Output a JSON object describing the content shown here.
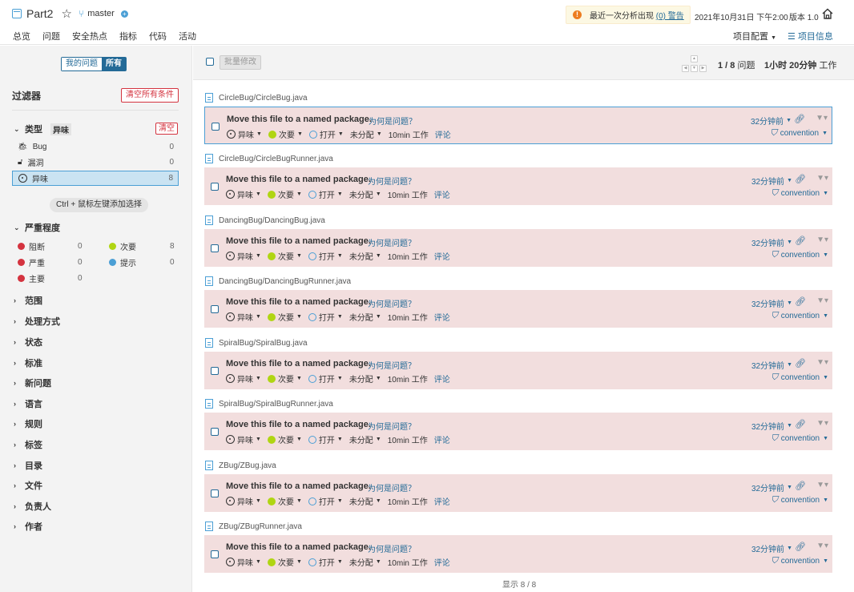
{
  "header": {
    "project": "Part2",
    "branch": "master",
    "warning_text": "最近一次分析出现",
    "warning_link": "(0) 警告",
    "date": "2021年10月31日 下午2:00",
    "version": "版本 1.0",
    "project_config": "项目配置",
    "project_info": "项目信息",
    "nav": [
      "总览",
      "问题",
      "安全热点",
      "指标",
      "代码",
      "活动"
    ]
  },
  "sidebar": {
    "my_issues": "我的问题",
    "all": "所有",
    "filters_title": "过滤器",
    "clear_all": "清空所有条件",
    "type": {
      "label": "类型",
      "badge": "异味",
      "clear": "清空",
      "items": [
        {
          "label": "Bug",
          "count": "0"
        },
        {
          "label": "漏洞",
          "count": "0"
        },
        {
          "label": "异味",
          "count": "8"
        }
      ]
    },
    "ctrl_hint": "Ctrl + 鼠标左键添加选择",
    "severity": {
      "label": "严重程度",
      "items": [
        {
          "label": "阻断",
          "count": "0"
        },
        {
          "label": "次要",
          "count": "8"
        },
        {
          "label": "严重",
          "count": "0"
        },
        {
          "label": "提示",
          "count": "0"
        },
        {
          "label": "主要",
          "count": "0"
        }
      ]
    },
    "collapsed": [
      "范围",
      "处理方式",
      "状态",
      "标准",
      "新问题",
      "语言",
      "规则",
      "标签",
      "目录",
      "文件",
      "负责人",
      "作者"
    ]
  },
  "toolbar": {
    "bulk": "批量修改",
    "paging_value": "1 / 8",
    "paging_unit": "问题",
    "effort_value": "1小时 20分钟",
    "effort_unit": "工作"
  },
  "issue_common": {
    "message": "Move this file to a named package.",
    "why": "为何是问题？",
    "type": "异味",
    "severity": "次要",
    "status": "打开",
    "assignee": "未分配",
    "effort": "10min 工作",
    "comment": "评论",
    "time": "32分钟前",
    "tag": "convention"
  },
  "issues": [
    {
      "file": "CircleBug/CircleBug.java"
    },
    {
      "file": "CircleBug/CircleBugRunner.java"
    },
    {
      "file": "DancingBug/DancingBug.java"
    },
    {
      "file": "DancingBug/DancingBugRunner.java"
    },
    {
      "file": "SpiralBug/SpiralBug.java"
    },
    {
      "file": "SpiralBug/SpiralBugRunner.java"
    },
    {
      "file": "ZBug/ZBug.java"
    },
    {
      "file": "ZBug/ZBugRunner.java"
    }
  ],
  "footer": "显示 8 / 8",
  "colors": {
    "accent": "#236a97",
    "card_bg": "#f2dede",
    "danger": "#d4333f",
    "minor": "#b0d513"
  }
}
